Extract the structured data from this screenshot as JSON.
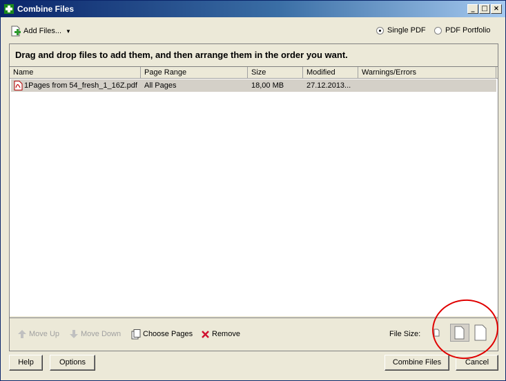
{
  "window": {
    "title": "Combine Files",
    "controls": {
      "minimize": "_",
      "maximize": "□",
      "close": "×"
    }
  },
  "toolbar": {
    "add_files_label": "Add Files...",
    "output_options": [
      {
        "label": "Single PDF",
        "selected": true
      },
      {
        "label": "PDF Portfolio",
        "selected": false
      }
    ]
  },
  "instructions": "Drag and drop files to add them, and then arrange them in the order you want.",
  "table": {
    "columns": [
      "Name",
      "Page Range",
      "Size",
      "Modified",
      "Warnings/Errors"
    ],
    "rows": [
      {
        "name": "1Pages from 54_fresh_1_16Z.pdf",
        "page_range": "All Pages",
        "size": "18,00 MB",
        "modified": "27.12.2013...",
        "warnings": "",
        "icon": "pdf-file-icon"
      }
    ]
  },
  "bottom_tools": {
    "move_up": "Move Up",
    "move_down": "Move Down",
    "choose_pages": "Choose Pages",
    "remove": "Remove",
    "file_size_label": "File Size:"
  },
  "buttons": {
    "help": "Help",
    "options": "Options",
    "combine": "Combine Files",
    "cancel": "Cancel"
  },
  "colors": {
    "titlebar_start": "#0a246a",
    "titlebar_end": "#a6caf0",
    "annotation": "#e00000",
    "selection_row": "#d4d0c8"
  }
}
